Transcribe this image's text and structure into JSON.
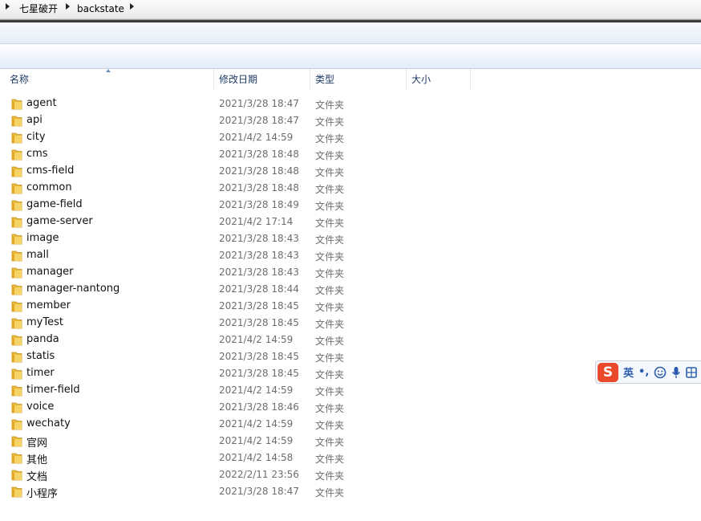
{
  "breadcrumb": {
    "items": [
      {
        "label": "七星破开"
      },
      {
        "label": "backstate"
      }
    ]
  },
  "columns": {
    "name": "名称",
    "date": "修改日期",
    "type": "类型",
    "size": "大小"
  },
  "files": [
    {
      "name": "agent",
      "date": "2021/3/28 18:47",
      "type": "文件夹"
    },
    {
      "name": "api",
      "date": "2021/3/28 18:47",
      "type": "文件夹"
    },
    {
      "name": "city",
      "date": "2021/4/2 14:59",
      "type": "文件夹"
    },
    {
      "name": "cms",
      "date": "2021/3/28 18:48",
      "type": "文件夹"
    },
    {
      "name": "cms-field",
      "date": "2021/3/28 18:48",
      "type": "文件夹"
    },
    {
      "name": "common",
      "date": "2021/3/28 18:48",
      "type": "文件夹"
    },
    {
      "name": "game-field",
      "date": "2021/3/28 18:49",
      "type": "文件夹"
    },
    {
      "name": "game-server",
      "date": "2021/4/2 17:14",
      "type": "文件夹"
    },
    {
      "name": "image",
      "date": "2021/3/28 18:43",
      "type": "文件夹"
    },
    {
      "name": "mall",
      "date": "2021/3/28 18:43",
      "type": "文件夹"
    },
    {
      "name": "manager",
      "date": "2021/3/28 18:43",
      "type": "文件夹"
    },
    {
      "name": "manager-nantong",
      "date": "2021/3/28 18:44",
      "type": "文件夹"
    },
    {
      "name": "member",
      "date": "2021/3/28 18:45",
      "type": "文件夹"
    },
    {
      "name": "myTest",
      "date": "2021/3/28 18:45",
      "type": "文件夹"
    },
    {
      "name": "panda",
      "date": "2021/4/2 14:59",
      "type": "文件夹"
    },
    {
      "name": "statis",
      "date": "2021/3/28 18:45",
      "type": "文件夹"
    },
    {
      "name": "timer",
      "date": "2021/3/28 18:45",
      "type": "文件夹"
    },
    {
      "name": "timer-field",
      "date": "2021/4/2 14:59",
      "type": "文件夹"
    },
    {
      "name": "voice",
      "date": "2021/3/28 18:46",
      "type": "文件夹"
    },
    {
      "name": "wechaty",
      "date": "2021/4/2 14:59",
      "type": "文件夹"
    },
    {
      "name": "官网",
      "date": "2021/4/2 14:59",
      "type": "文件夹"
    },
    {
      "name": "其他",
      "date": "2021/4/2 14:58",
      "type": "文件夹"
    },
    {
      "name": "文档",
      "date": "2022/2/11 23:56",
      "type": "文件夹"
    },
    {
      "name": "小程序",
      "date": "2021/3/28 18:47",
      "type": "文件夹"
    }
  ],
  "ime": {
    "logo": "S",
    "lang": "英",
    "punct": "•,",
    "icons": [
      "smiley-icon",
      "microphone-icon",
      "toolbox-icon"
    ]
  },
  "colors": {
    "header_text": "#1f3b66",
    "meta_text": "#6d6d6d",
    "folder": "#e8b93a",
    "ime_accent": "#e8492b"
  }
}
